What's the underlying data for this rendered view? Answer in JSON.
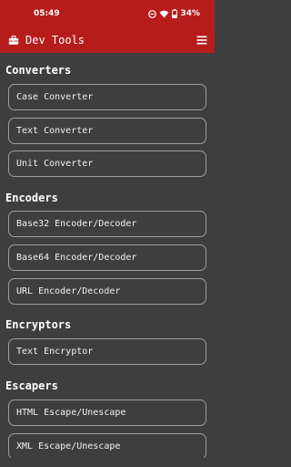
{
  "status_bar": {
    "time": "05:49",
    "battery": "34%"
  },
  "app_bar": {
    "title": "Dev Tools"
  },
  "sections": [
    {
      "title": "Converters",
      "items": [
        "Case Converter",
        "Text Converter",
        "Unit Converter"
      ]
    },
    {
      "title": "Encoders",
      "items": [
        "Base32 Encoder/Decoder",
        "Base64 Encoder/Decoder",
        "URL Encoder/Decoder"
      ]
    },
    {
      "title": "Encryptors",
      "items": [
        "Text Encryptor"
      ]
    },
    {
      "title": "Escapers",
      "items": [
        "HTML Escape/Unescape",
        "XML Escape/Unescape"
      ]
    }
  ],
  "colors": {
    "app_bar": "#b71c1c",
    "background": "#3e3e3e",
    "card_border": "#9e9e9e"
  },
  "icons": [
    "toolbox-icon",
    "hamburger-menu-icon",
    "do-not-disturb-icon",
    "wifi-icon",
    "battery-icon"
  ]
}
